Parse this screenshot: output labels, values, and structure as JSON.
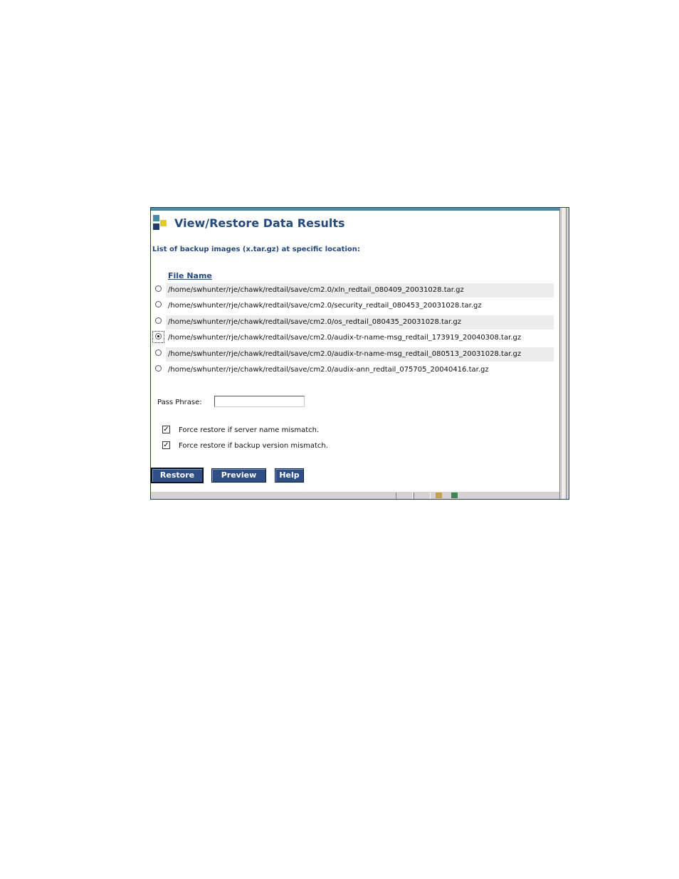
{
  "page": {
    "title": "View/Restore Data Results",
    "list_label": "List of backup images (x.tar.gz) at specific location:",
    "column_header": "File Name"
  },
  "files": [
    {
      "path": "/home/swhunter/rje/chawk/redtail/save/cm2.0/xln_redtail_080409_20031028.tar.gz",
      "selected": false
    },
    {
      "path": "/home/swhunter/rje/chawk/redtail/save/cm2.0/security_redtail_080453_20031028.tar.gz",
      "selected": false
    },
    {
      "path": "/home/swhunter/rje/chawk/redtail/save/cm2.0/os_redtail_080435_20031028.tar.gz",
      "selected": false
    },
    {
      "path": "/home/swhunter/rje/chawk/redtail/save/cm2.0/audix-tr-name-msg_redtail_173919_20040308.tar.gz",
      "selected": true
    },
    {
      "path": "/home/swhunter/rje/chawk/redtail/save/cm2.0/audix-tr-name-msg_redtail_080513_20031028.tar.gz",
      "selected": false
    },
    {
      "path": "/home/swhunter/rje/chawk/redtail/save/cm2.0/audix-ann_redtail_075705_20040416.tar.gz",
      "selected": false
    }
  ],
  "pass_phrase": {
    "label": "Pass Phrase:",
    "value": ""
  },
  "options": {
    "force_server_name": {
      "label": "Force restore if server name mismatch.",
      "checked": true
    },
    "force_backup_version": {
      "label": "Force restore if backup version mismatch.",
      "checked": true
    }
  },
  "buttons": {
    "restore": "Restore",
    "preview": "Preview",
    "help": "Help"
  },
  "colors": {
    "title": "#234a80",
    "button": "#2d4f86",
    "top_bar": "#3f8fa8",
    "row_shade": "#ececec"
  }
}
